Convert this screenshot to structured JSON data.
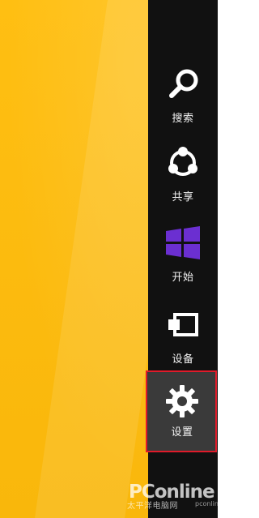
{
  "screen": {
    "accent_color": "#111111",
    "background_color": "#f9b80f",
    "selected_highlight_color": "#3a3a3a",
    "selection_outline_color": "#e01b2a"
  },
  "charms": [
    {
      "label": "搜索",
      "icon": "search-icon"
    },
    {
      "label": "共享",
      "icon": "share-icon"
    },
    {
      "label": "开始",
      "icon": "windows-logo-icon",
      "icon_color": "#6b2fd1"
    },
    {
      "label": "设备",
      "icon": "devices-icon"
    },
    {
      "label": "设置",
      "icon": "settings-gear-icon",
      "selected": true
    }
  ],
  "watermark": {
    "title": "PConline",
    "subtitle": "太平洋电脑网",
    "domain": "pconline.com.cn"
  }
}
